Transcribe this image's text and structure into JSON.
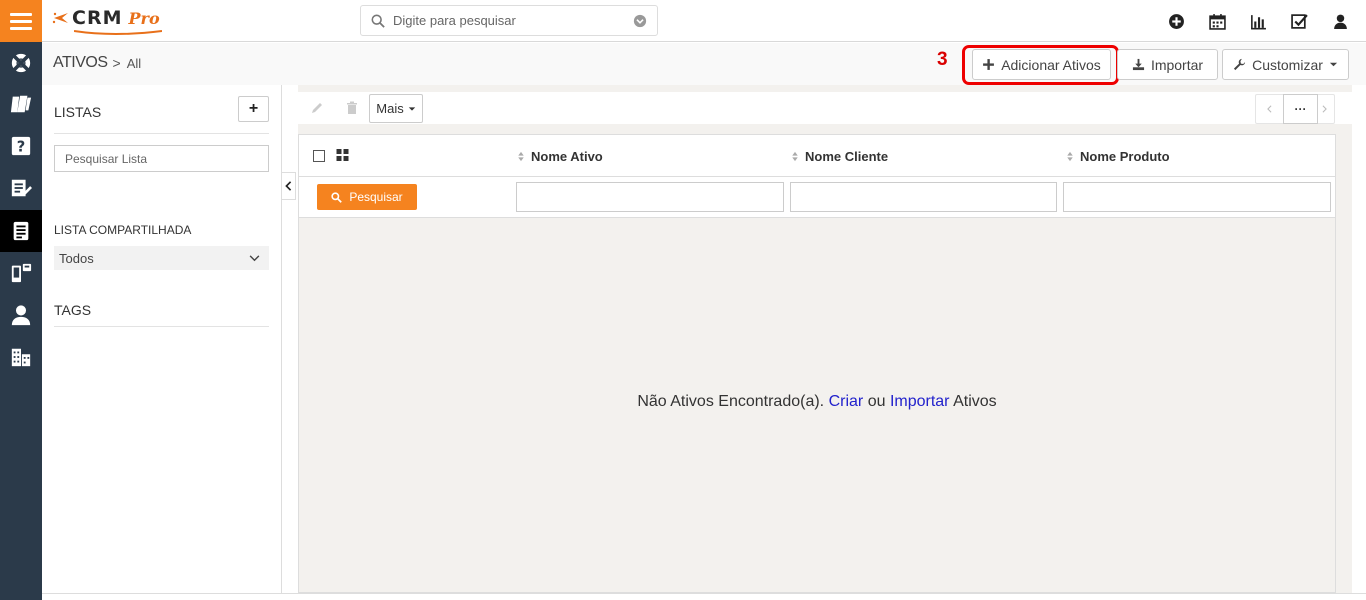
{
  "app": {
    "logo_main": "CRM",
    "logo_suffix": "Pro",
    "brand_color": "#f5831f",
    "rail_color": "#2b3a4a"
  },
  "search": {
    "placeholder": "Digite para pesquisar"
  },
  "top_icons": [
    "plus-circle-icon",
    "calendar-icon",
    "chart-icon",
    "task-check-icon",
    "user-icon"
  ],
  "rail_icons": [
    "menu-icon",
    "support-lifebuoy-icon",
    "documents-icon",
    "help-icon",
    "edit-list-icon",
    "assets-icon",
    "devices-icon",
    "contacts-icon",
    "organizations-icon"
  ],
  "breadcrumb": {
    "module": "ATIVOS",
    "separator": ">",
    "filter": "All"
  },
  "annotation": {
    "step": "3",
    "color": "#e00000"
  },
  "actions": {
    "add": "Adicionar Ativos",
    "import": "Importar",
    "customize": "Customizar"
  },
  "sidebar": {
    "lists_title": "LISTAS",
    "add_label": "+",
    "search_placeholder": "Pesquisar Lista",
    "shared_title": "LISTA COMPARTILHADA",
    "shared_selected": "Todos",
    "tags_title": "TAGS"
  },
  "toolbar": {
    "more": "Mais",
    "pager_more": "···"
  },
  "table": {
    "columns": [
      "Nome Ativo",
      "Nome Cliente",
      "Nome Produto"
    ],
    "search_button": "Pesquisar"
  },
  "empty_state": {
    "prefix": "Não Ativos Encontrado(a).",
    "create_link": "Criar",
    "middle": "ou",
    "import_link": "Importar",
    "suffix": "Ativos"
  }
}
